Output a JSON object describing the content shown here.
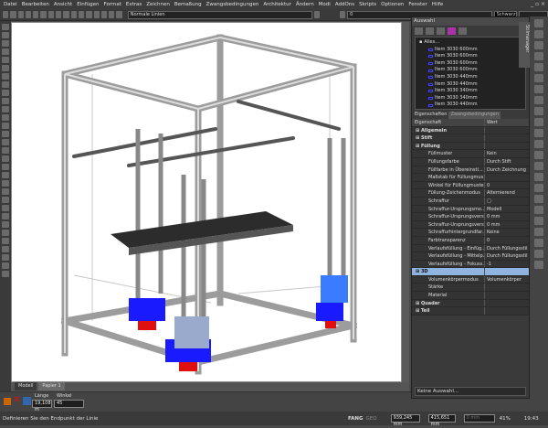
{
  "menu": [
    "Datei",
    "Bearbeiten",
    "Ansicht",
    "Einfügen",
    "Format",
    "Extras",
    "Zeichnen",
    "Bemaßung",
    "Zwangsbedingungen",
    "Architektur",
    "Ändern",
    "Modi",
    "AddOns",
    "Skripts",
    "Optionen",
    "Fenster",
    "Hilfe"
  ],
  "window_controls": "_ ▫ ×",
  "toolbar": {
    "linetype": "Normale Linien",
    "layer": "0",
    "color": "Schwarz"
  },
  "panel": {
    "title": "Auswahl",
    "tree_root": "Alles...",
    "tree_items": [
      "Item 3030 600mm",
      "Item 3030 600mm",
      "Item 3030 600mm",
      "Item 3030 600mm",
      "Item 3030 440mm",
      "Item 3030 440mm",
      "Item 3030 340mm",
      "Item 3030 340mm",
      "Item 3030 440mm"
    ],
    "tabs": [
      "Eigenschaften",
      "Zwangsbedingungen"
    ],
    "col_property": "Eigenschaft",
    "col_value": "Wert",
    "rows": [
      {
        "k": "Allgemein",
        "v": "",
        "cat": true
      },
      {
        "k": "Stift",
        "v": "",
        "cat": true
      },
      {
        "k": "Füllung",
        "v": "",
        "cat": true
      },
      {
        "k": "Füllmuster",
        "v": "Kein"
      },
      {
        "k": "Füllungsfarbe",
        "v": "Durch Stift"
      },
      {
        "k": "Füllfarbe in Übereinsti...",
        "v": "Durch Zeichnung"
      },
      {
        "k": "Maßstab für Füllungmus...",
        "v": ""
      },
      {
        "k": "Winkel für Füllungmuster",
        "v": "0"
      },
      {
        "k": "Füllung-Zeichenmodus",
        "v": "Alternierend"
      },
      {
        "k": "Schraffur",
        "v": "□"
      },
      {
        "k": "Schraffur-Ursprungsmo...",
        "v": "Modell"
      },
      {
        "k": "Schraffur-Ursprungsvers...",
        "v": "0 mm"
      },
      {
        "k": "Schraffur-Ursprungsvers...",
        "v": "0 mm"
      },
      {
        "k": "Schraffurhintergrundfar...",
        "v": "Keine"
      },
      {
        "k": "Farbtransparenz",
        "v": "0"
      },
      {
        "k": "Verlaufsfüllung - Einfüg...",
        "v": "Durch Füllungsstil"
      },
      {
        "k": "Verlaufsfüllung - Mittelp...",
        "v": "Durch Füllungsstil"
      },
      {
        "k": "Verlaufsfüllung - Fokuss...",
        "v": "-1"
      },
      {
        "k": "3D",
        "v": "",
        "cat": true,
        "hl": true
      },
      {
        "k": "Volumenkörpermodus",
        "v": "Volumenkörper"
      },
      {
        "k": "Stärke",
        "v": ""
      },
      {
        "k": "Material",
        "v": ""
      },
      {
        "k": "Quader",
        "v": "",
        "cat": true
      },
      {
        "k": "Teil",
        "v": "",
        "cat": true
      }
    ],
    "selection_status": "Keine Auswahl..."
  },
  "side_tab": "Stilmanager",
  "sheet_tabs": [
    "Modell",
    "Papier 1"
  ],
  "cmd": {
    "length_label": "Länge",
    "length_value": "19,108 m",
    "angle_label": "Winkel",
    "angle_value": "45"
  },
  "status": {
    "prompt": "Definieren Sie den Endpunkt der Linie",
    "fang": "FANG",
    "geo": "GEO",
    "x": "939,245 mm",
    "y": "415,651 mm",
    "z": "0 mm",
    "zoom": "41%",
    "time": "19:43"
  },
  "colors": {
    "motor": "#1a1aff",
    "accent_red": "#e01010",
    "platform": "#333333",
    "highlight": "#8fb4e0"
  }
}
